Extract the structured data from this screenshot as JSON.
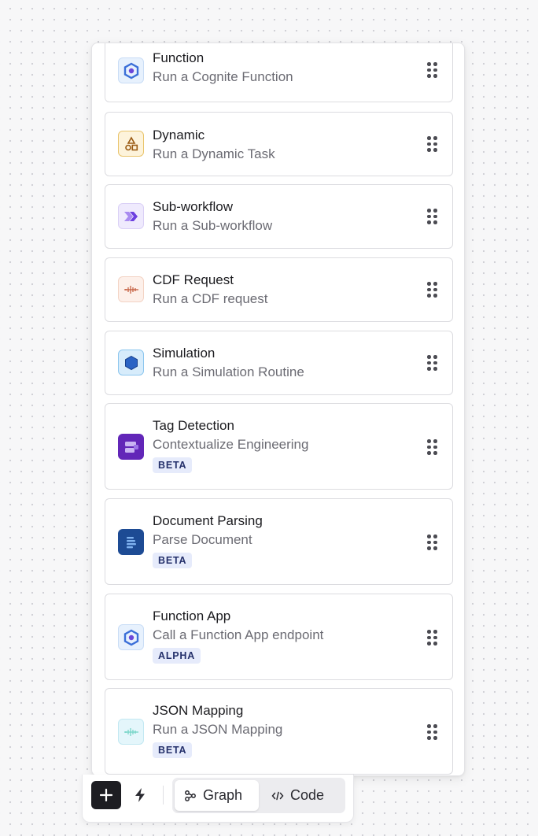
{
  "tasks": [
    {
      "title": "Function",
      "subtitle": "Run a Cognite Function",
      "icon": "cognite-function-icon"
    },
    {
      "title": "Dynamic",
      "subtitle": "Run a Dynamic Task",
      "icon": "shapes-icon"
    },
    {
      "title": "Sub-workflow",
      "subtitle": "Run a Sub-workflow",
      "icon": "chevrons-right-icon"
    },
    {
      "title": "CDF Request",
      "subtitle": "Run a CDF request",
      "icon": "waveform-icon"
    },
    {
      "title": "Simulation",
      "subtitle": "Run a Simulation Routine",
      "icon": "hexagon-icon"
    },
    {
      "title": "Tag Detection",
      "subtitle": "Contextualize Engineering",
      "badge": "BETA",
      "icon": "tag-detection-icon"
    },
    {
      "title": "Document Parsing",
      "subtitle": "Parse Document",
      "badge": "BETA",
      "icon": "document-icon"
    },
    {
      "title": "Function App",
      "subtitle": "Call a Function App endpoint",
      "badge": "ALPHA",
      "icon": "cognite-function-icon"
    },
    {
      "title": "JSON Mapping",
      "subtitle": "Run a JSON Mapping",
      "badge": "BETA",
      "icon": "waveform-icon"
    }
  ],
  "toolbar": {
    "add_icon": "plus-icon",
    "bolt_icon": "lightning-icon",
    "graph_label": "Graph",
    "code_label": "Code",
    "active_view": "Graph"
  },
  "colors": {
    "badge_bg": "#e6ebfb",
    "badge_text": "#24306b",
    "add_button": "#1d1d22"
  }
}
